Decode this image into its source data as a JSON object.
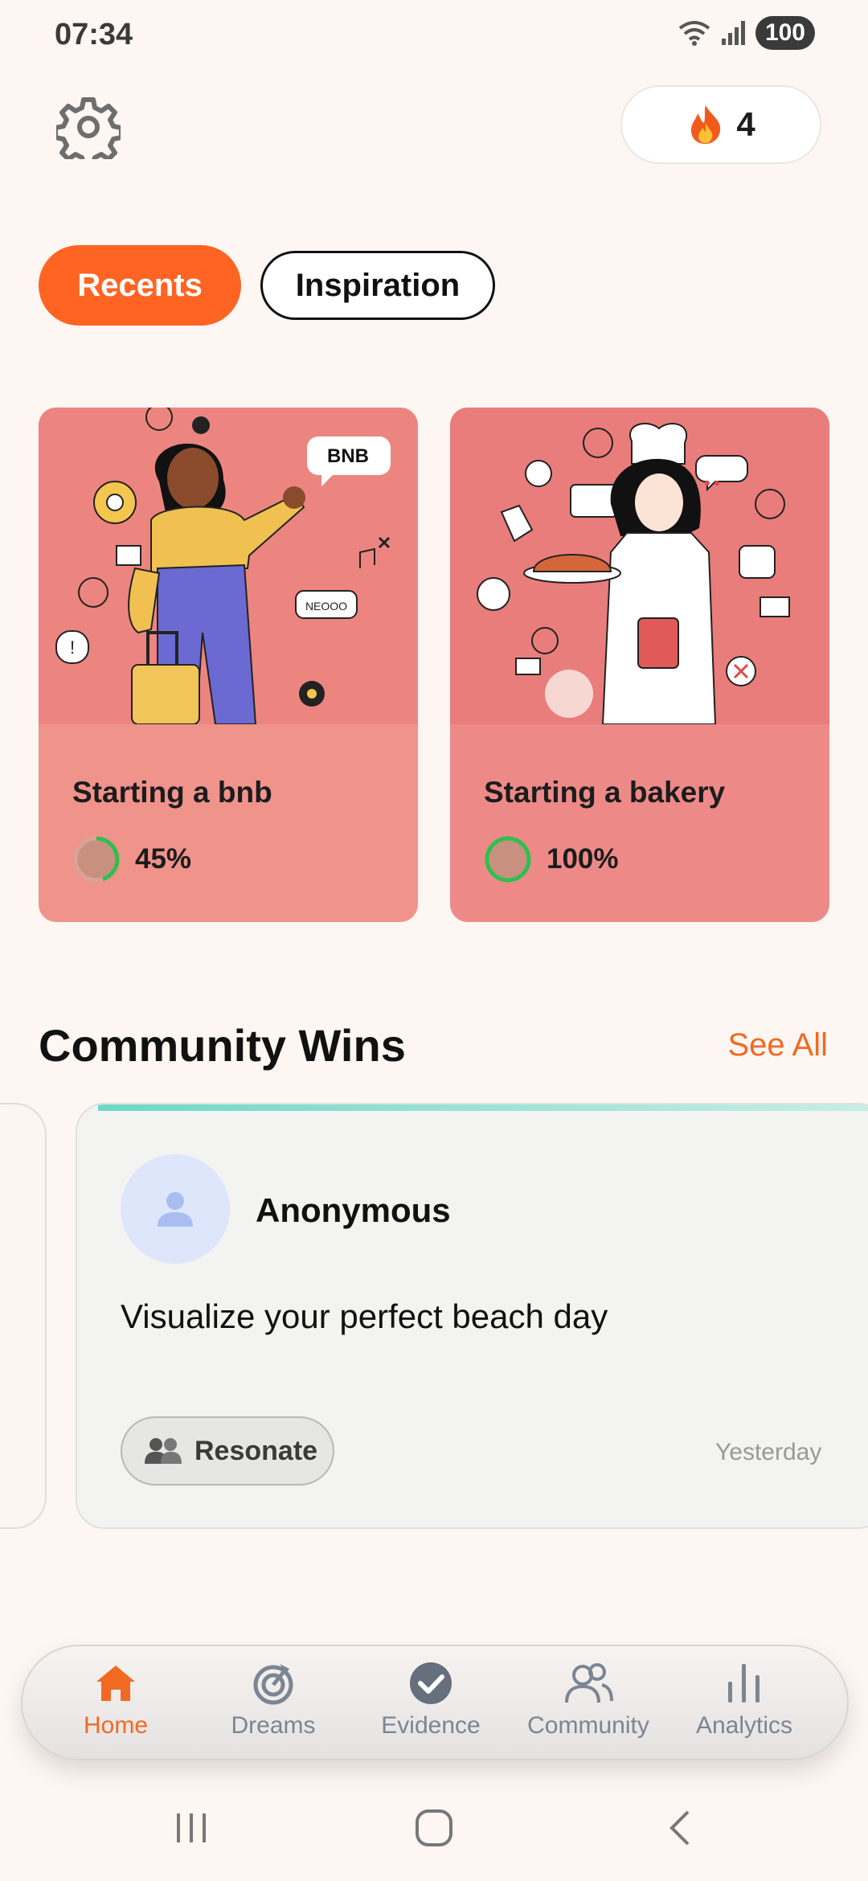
{
  "status_bar": {
    "time": "07:34",
    "battery": "100"
  },
  "header": {
    "streak_count": "4",
    "streak_icon": "fire-icon",
    "settings_icon": "gear-icon"
  },
  "tabs": [
    {
      "label": "Recents",
      "active": true
    },
    {
      "label": "Inspiration",
      "active": false
    }
  ],
  "cards": [
    {
      "title": "Starting a bnb",
      "progress_label": "45%",
      "progress": 0.45,
      "image_badge": "BNB",
      "image_tag": "NEOOO"
    },
    {
      "title": "Starting a bakery",
      "progress_label": "100%",
      "progress": 1.0
    }
  ],
  "community": {
    "title": "Community Wins",
    "see_all": "See All",
    "win": {
      "author": "Anonymous",
      "text": "Visualize your perfect beach day",
      "resonate_label": "Resonate",
      "time": "Yesterday"
    }
  },
  "bottom_nav": [
    {
      "label": "Home",
      "icon": "home-icon",
      "active": true
    },
    {
      "label": "Dreams",
      "icon": "target-icon",
      "active": false
    },
    {
      "label": "Evidence",
      "icon": "check-circle-icon",
      "active": false
    },
    {
      "label": "Community",
      "icon": "users-icon",
      "active": false
    },
    {
      "label": "Analytics",
      "icon": "bar-chart-icon",
      "active": false
    }
  ],
  "colors": {
    "accent": "#ff6422",
    "progress": "#2ec04f",
    "card_bnb": "#f0938b",
    "card_bakery": "#ed8a88"
  }
}
